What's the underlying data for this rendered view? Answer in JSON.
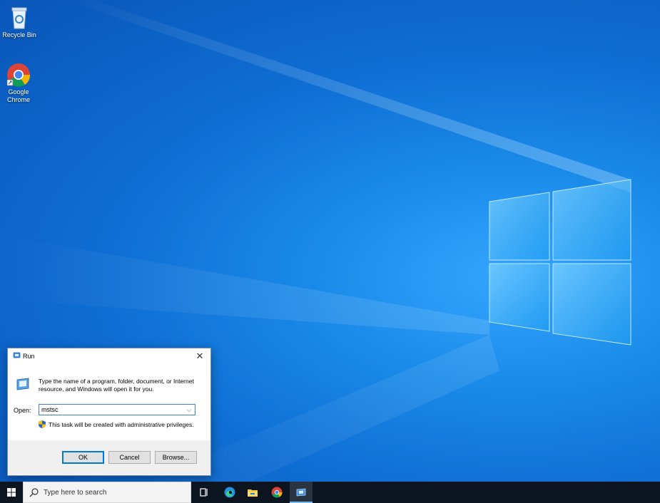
{
  "desktop": {
    "icons": [
      {
        "label": "Recycle Bin",
        "icon": "recycle-bin-icon"
      },
      {
        "label": "Google Chrome",
        "icon": "chrome-icon"
      }
    ]
  },
  "run_dialog": {
    "title": "Run",
    "description": "Type the name of a program, folder, document, or Internet resource, and Windows will open it for you.",
    "open_label": "Open:",
    "open_value": "mstsc",
    "admin_note": "This task will be created with administrative privileges.",
    "ok_label": "OK",
    "cancel_label": "Cancel",
    "browse_label": "Browse..."
  },
  "taskbar": {
    "search_placeholder": "Type here to search",
    "items": [
      "task-view-icon",
      "edge-icon",
      "file-explorer-icon",
      "chrome-icon",
      "run-icon"
    ]
  },
  "colors": {
    "desktop_blue": "#0f6fd4",
    "taskbar": "#0c1420",
    "accent": "#0078d7"
  }
}
